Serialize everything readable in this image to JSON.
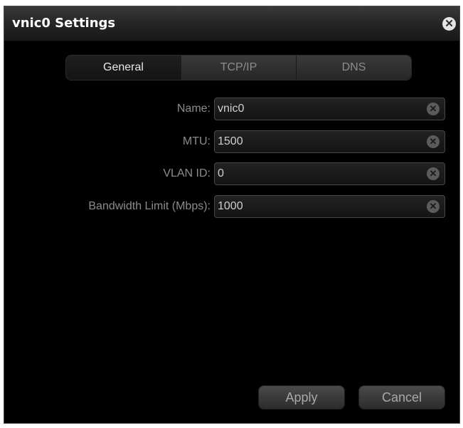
{
  "dialog": {
    "title": "vnic0 Settings",
    "close_icon": "close-icon"
  },
  "tabs": [
    {
      "label": "General",
      "active": true
    },
    {
      "label": "TCP/IP",
      "active": false
    },
    {
      "label": "DNS",
      "active": false
    }
  ],
  "fields": {
    "name": {
      "label": "Name:",
      "value": "vnic0"
    },
    "mtu": {
      "label": "MTU:",
      "value": "1500"
    },
    "vlan_id": {
      "label": "VLAN ID:",
      "value": "0"
    },
    "bandwidth": {
      "label": "Bandwidth Limit (Mbps):",
      "value": "1000"
    }
  },
  "buttons": {
    "apply": "Apply",
    "cancel": "Cancel"
  },
  "colors": {
    "background": "#000000",
    "text_label": "#8c8c8c",
    "text_value": "#cfcfcf"
  }
}
